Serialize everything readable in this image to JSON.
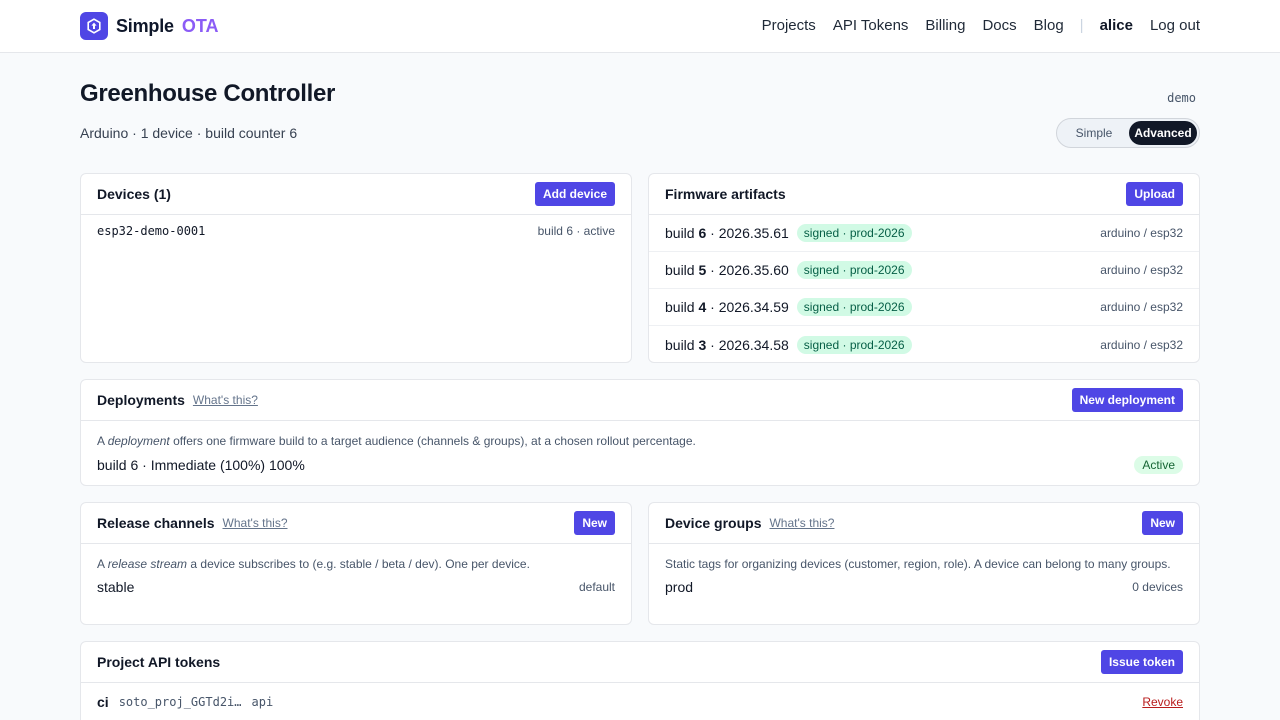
{
  "brand": {
    "name": "Simple",
    "accent": "OTA"
  },
  "nav": {
    "items": [
      "Projects",
      "API Tokens",
      "Billing",
      "Docs",
      "Blog"
    ],
    "separator": "|",
    "user": "alice",
    "logout": "Log out"
  },
  "project": {
    "title": "Greenhouse Controller",
    "subtitle": "Arduino · 1 device · build counter 6",
    "tag": "demo",
    "mode_options": {
      "simple": "Simple",
      "advanced": "Advanced"
    },
    "mode_selected": "Advanced"
  },
  "devices": {
    "title": "Devices (1)",
    "button": "Add device",
    "items": [
      {
        "id": "esp32-demo-0001",
        "meta": "build 6 · active"
      }
    ]
  },
  "firmware": {
    "title": "Firmware artifacts",
    "button": "Upload",
    "items": [
      {
        "prefix": "build",
        "num": "6",
        "version": "· 2026.35.61",
        "badge": "signed · prod-2026",
        "target": "arduino / esp32"
      },
      {
        "prefix": "build",
        "num": "5",
        "version": "· 2026.35.60",
        "badge": "signed · prod-2026",
        "target": "arduino / esp32"
      },
      {
        "prefix": "build",
        "num": "4",
        "version": "· 2026.34.59",
        "badge": "signed · prod-2026",
        "target": "arduino / esp32"
      },
      {
        "prefix": "build",
        "num": "3",
        "version": "· 2026.34.58",
        "badge": "signed · prod-2026",
        "target": "arduino / esp32"
      }
    ]
  },
  "deployments": {
    "title": "Deployments",
    "help": "What's this?",
    "button": "New deployment",
    "desc_a": "A ",
    "desc_em": "deployment",
    "desc_b": " offers one firmware build to a target audience (channels & groups), at a chosen rollout percentage.",
    "item": "build 6 · Immediate (100%) 100%",
    "status": "Active"
  },
  "channels": {
    "title": "Release channels",
    "help": "What's this?",
    "button": "New",
    "desc_a": "A ",
    "desc_em": "release stream",
    "desc_b": " a device subscribes to (e.g. stable / beta / dev). One per device.",
    "item": "stable",
    "meta": "default"
  },
  "groups": {
    "title": "Device groups",
    "help": "What's this?",
    "button": "New",
    "desc": "Static tags for organizing devices (customer, region, role). A device can belong to many groups.",
    "item": "prod",
    "meta": "0 devices"
  },
  "tokens": {
    "title": "Project API tokens",
    "button": "Issue token",
    "item": {
      "name": "ci",
      "value": "soto_proj_GGTd2i…",
      "scope": "api",
      "action": "Revoke"
    }
  },
  "colors": {
    "accent": "#4f46e5",
    "brand_accent": "#8b5cf6",
    "badge_green": "#d1fae5",
    "danger": "#b91c1c"
  },
  "icons": {
    "logo": "hexagon-arrow-icon"
  }
}
